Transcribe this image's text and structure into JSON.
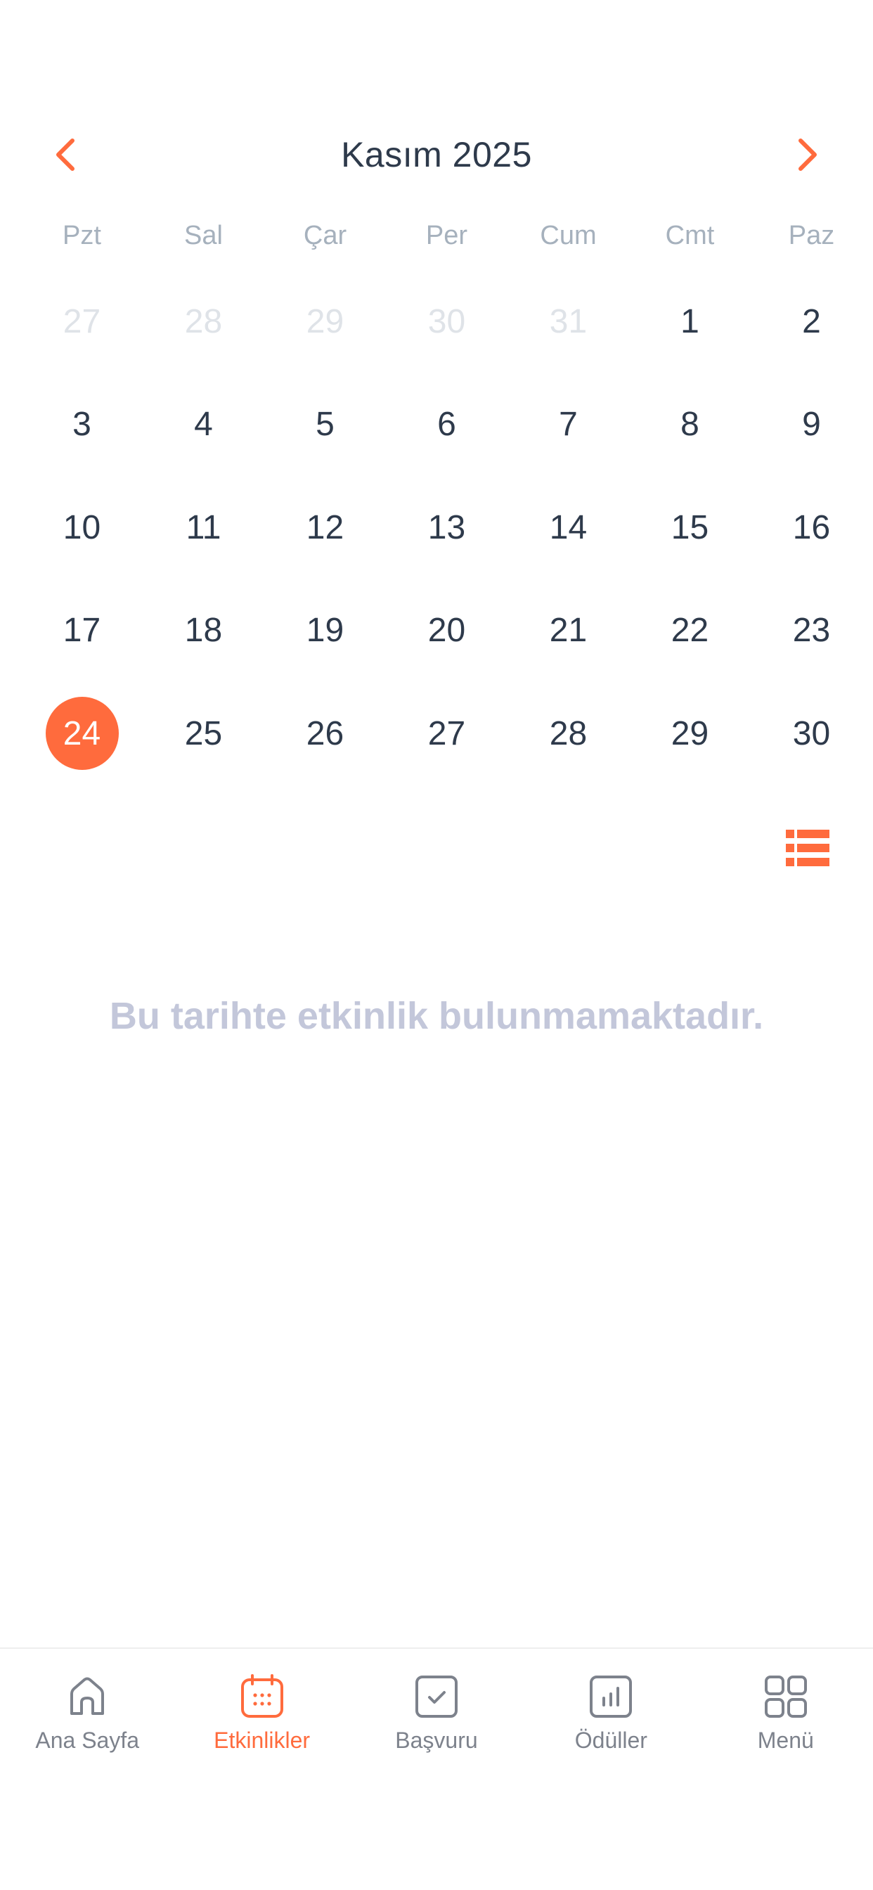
{
  "calendar": {
    "month_title": "Kasım 2025",
    "weekdays": [
      "Pzt",
      "Sal",
      "Çar",
      "Per",
      "Cum",
      "Cmt",
      "Paz"
    ],
    "days": [
      {
        "label": "27",
        "muted": true
      },
      {
        "label": "28",
        "muted": true
      },
      {
        "label": "29",
        "muted": true
      },
      {
        "label": "30",
        "muted": true
      },
      {
        "label": "31",
        "muted": true
      },
      {
        "label": "1"
      },
      {
        "label": "2"
      },
      {
        "label": "3"
      },
      {
        "label": "4"
      },
      {
        "label": "5"
      },
      {
        "label": "6"
      },
      {
        "label": "7"
      },
      {
        "label": "8"
      },
      {
        "label": "9"
      },
      {
        "label": "10"
      },
      {
        "label": "11"
      },
      {
        "label": "12"
      },
      {
        "label": "13"
      },
      {
        "label": "14"
      },
      {
        "label": "15"
      },
      {
        "label": "16"
      },
      {
        "label": "17"
      },
      {
        "label": "18"
      },
      {
        "label": "19"
      },
      {
        "label": "20"
      },
      {
        "label": "21"
      },
      {
        "label": "22"
      },
      {
        "label": "23"
      },
      {
        "label": "24",
        "selected": true
      },
      {
        "label": "25"
      },
      {
        "label": "26"
      },
      {
        "label": "27"
      },
      {
        "label": "28"
      },
      {
        "label": "29"
      },
      {
        "label": "30"
      }
    ],
    "prev_icon": "chevron-left-icon",
    "next_icon": "chevron-right-icon",
    "list_view_icon": "list-view-icon"
  },
  "events": {
    "empty_message": "Bu tarihte etkinlik bulunmamaktadır."
  },
  "tabs": [
    {
      "label": "Ana Sayfa",
      "icon": "home-icon"
    },
    {
      "label": "Etkinlikler",
      "icon": "calendar-icon",
      "active": true
    },
    {
      "label": "Başvuru",
      "icon": "checkbox-icon"
    },
    {
      "label": "Ödüller",
      "icon": "bar-chart-icon"
    },
    {
      "label": "Menü",
      "icon": "grid-icon"
    }
  ],
  "colors": {
    "accent": "#ff6b3d",
    "text_primary": "#2e3a4b",
    "text_muted": "#dfe3e8",
    "weekday": "#a6b1bd",
    "empty_text": "#c3c7da",
    "tab_inactive": "#7d828c"
  }
}
